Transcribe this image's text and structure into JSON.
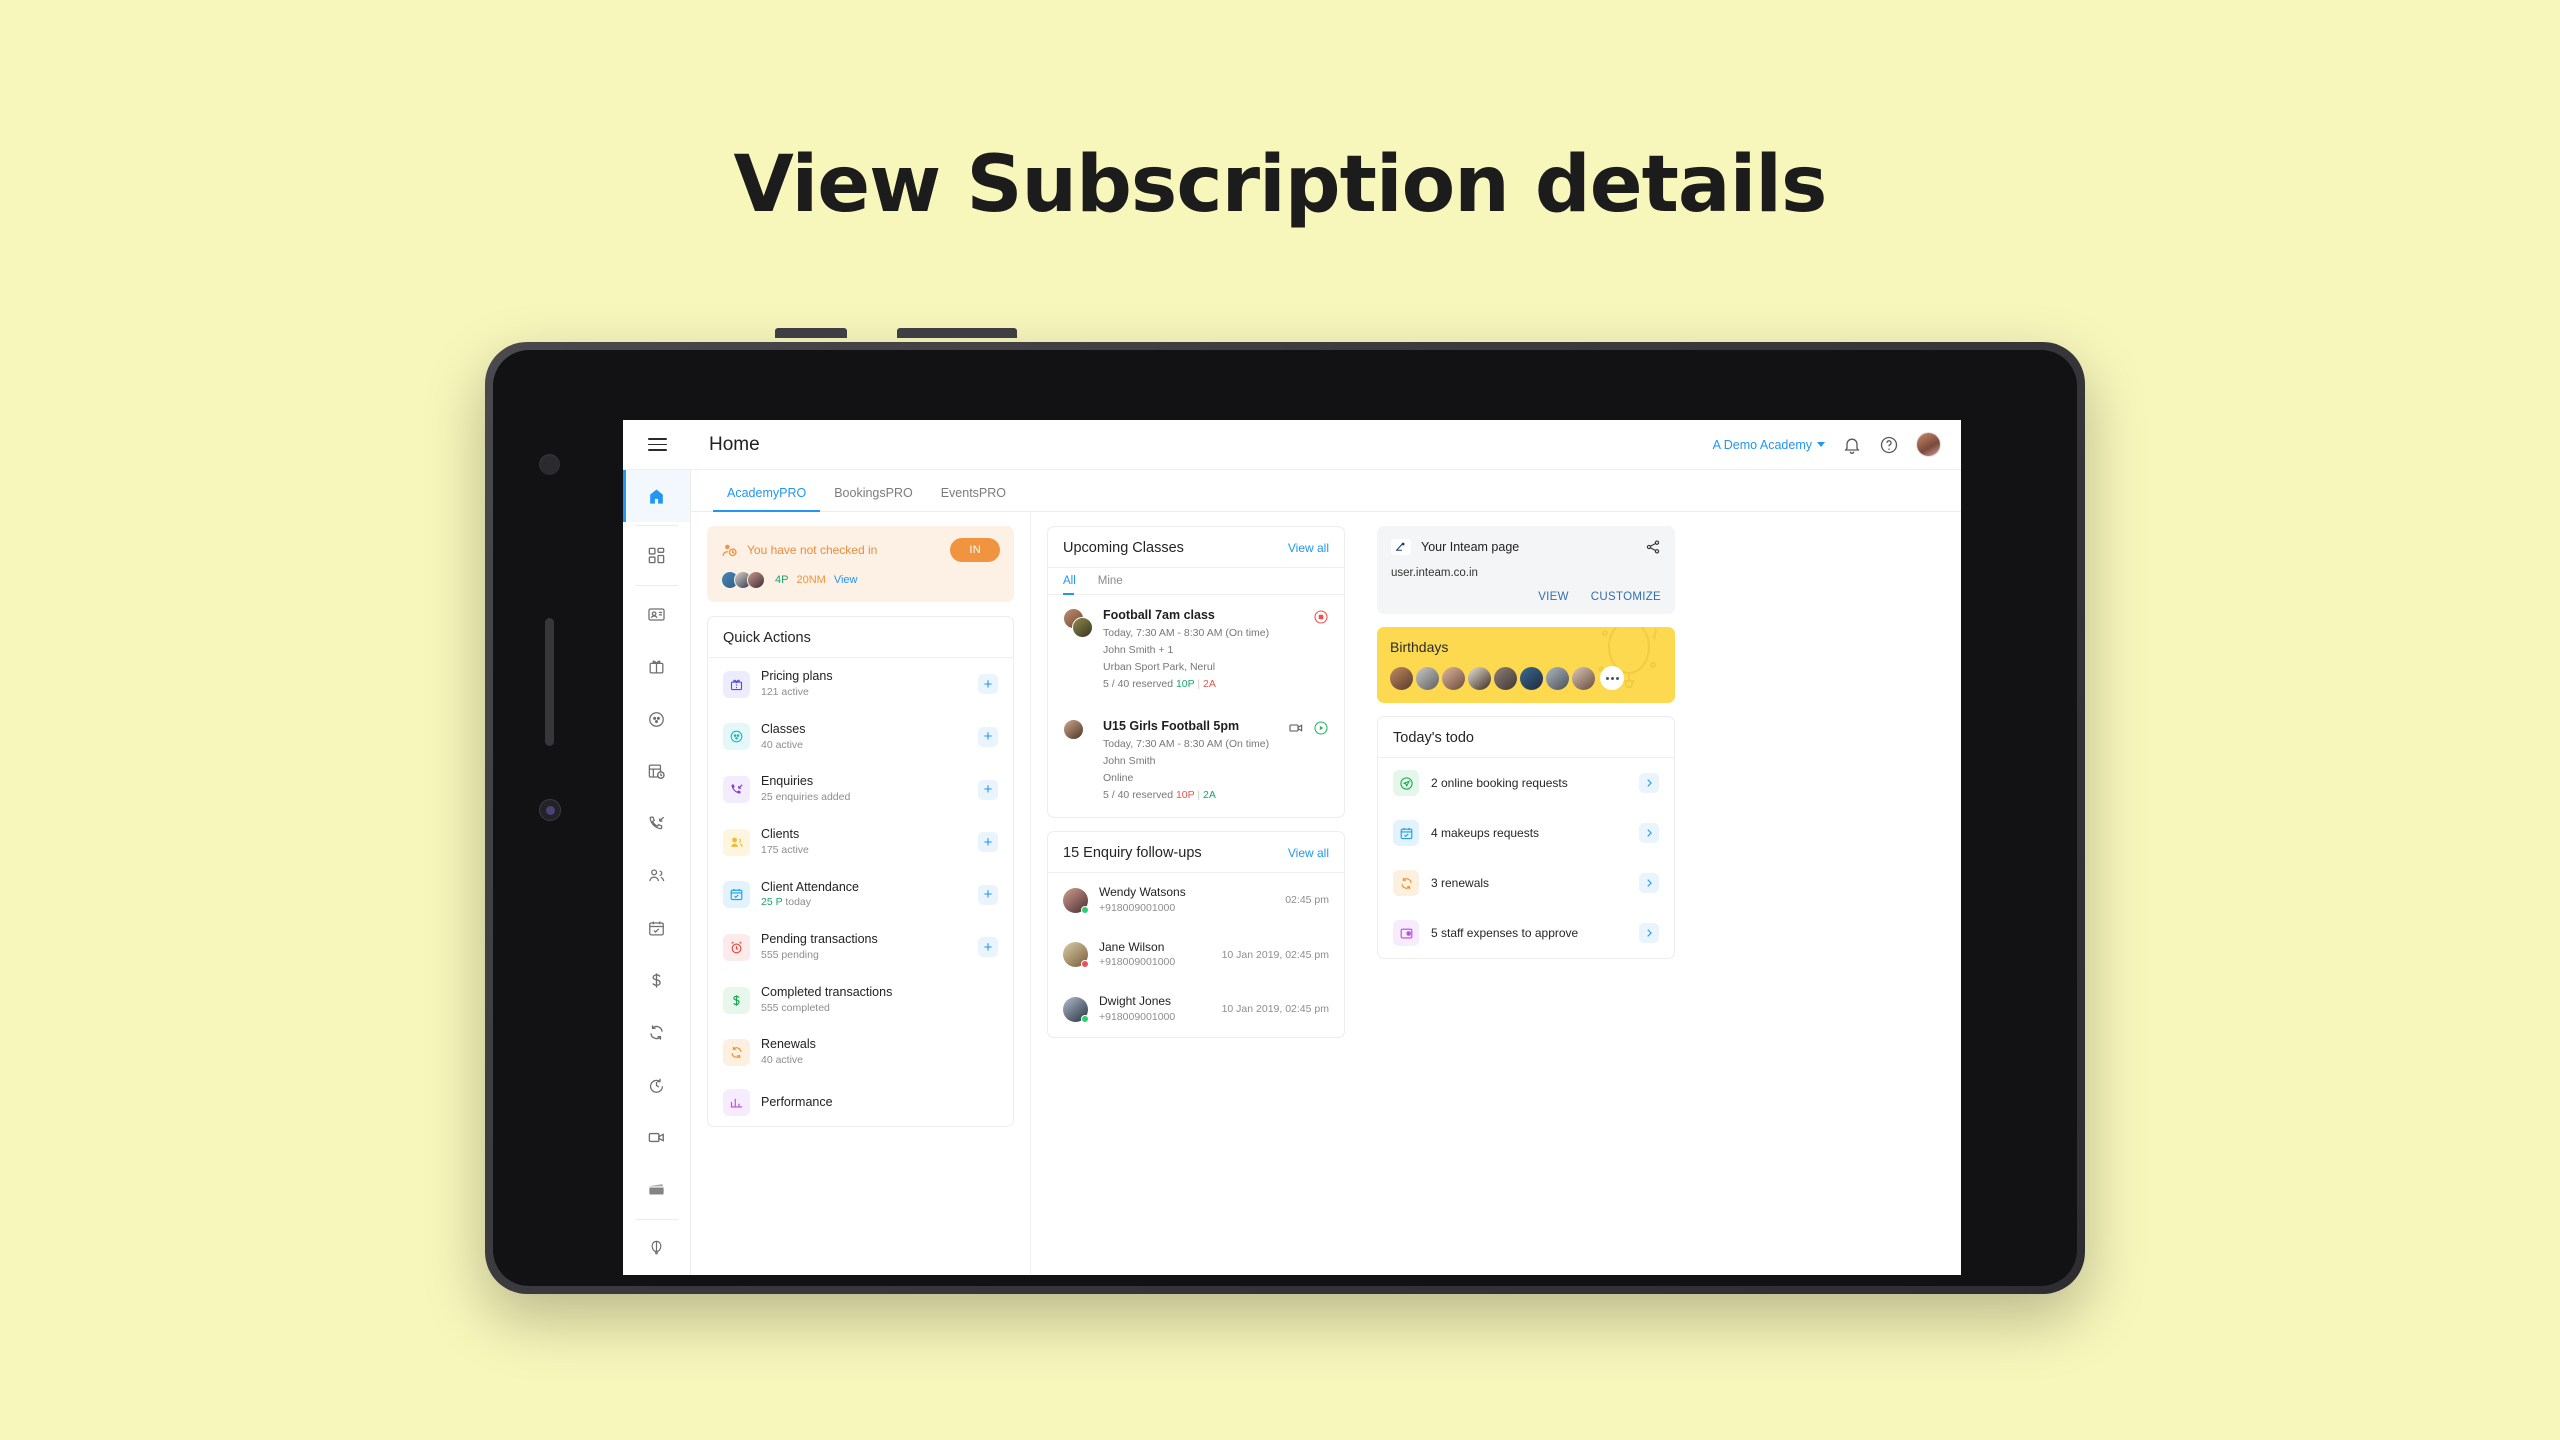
{
  "hero": {
    "title": "View Subscription details"
  },
  "header": {
    "menu_icon": "hamburger-icon",
    "page_title": "Home",
    "academy": "A Demo Academy",
    "bell_icon": "bell-icon",
    "help_icon": "help-circle-icon",
    "avatar": "user-avatar"
  },
  "tabs": [
    {
      "label": "AcademyPRO",
      "active": true
    },
    {
      "label": "BookingsPRO",
      "active": false
    },
    {
      "label": "EventsPRO",
      "active": false
    }
  ],
  "sidebar": {
    "items": [
      {
        "name": "home",
        "active": true
      },
      {
        "name": "dashboard",
        "active": false
      },
      {
        "name": "id-card",
        "active": false
      },
      {
        "name": "gift",
        "active": false
      },
      {
        "name": "classes",
        "active": false
      },
      {
        "name": "schedule",
        "active": false
      },
      {
        "name": "enquiries",
        "active": false
      },
      {
        "name": "clients",
        "active": false
      },
      {
        "name": "attendance",
        "active": false
      },
      {
        "name": "payments",
        "active": false
      },
      {
        "name": "renewals",
        "active": false
      },
      {
        "name": "timer",
        "active": false
      },
      {
        "name": "video",
        "active": false
      },
      {
        "name": "card",
        "active": false
      },
      {
        "name": "balloon",
        "active": false
      }
    ]
  },
  "checkin": {
    "message": "You have not checked in",
    "button": "IN",
    "present": "4P",
    "not_marked": "20NM",
    "view": "View",
    "avatar_colors": [
      "#4a86b8",
      "#2b3a56",
      "#5b3a4e"
    ]
  },
  "quick_actions": {
    "title": "Quick Actions",
    "items": [
      {
        "name": "Pricing plans",
        "sub": "121 active",
        "sub_green": "",
        "icon": "gift-icon",
        "bg": "#edecfd",
        "fg": "#5b4ddb",
        "plus": true
      },
      {
        "name": "Classes",
        "sub": "40 active",
        "sub_green": "",
        "icon": "class-icon",
        "bg": "#e4f8f9",
        "fg": "#15b8c4",
        "plus": true
      },
      {
        "name": "Enquiries",
        "sub": "25 enquiries added",
        "sub_green": "",
        "icon": "phone-incoming-icon",
        "bg": "#f2ecfd",
        "fg": "#7c3fd6",
        "plus": true
      },
      {
        "name": "Clients",
        "sub": "175 active",
        "sub_green": "",
        "icon": "people-icon",
        "bg": "#fdf5dd",
        "fg": "#f0bc33",
        "plus": true
      },
      {
        "name": "Client Attendance",
        "sub": " today",
        "sub_green": "25 P",
        "icon": "calendar-check-icon",
        "bg": "#e3f3fd",
        "fg": "#1aa0e8",
        "plus": true
      },
      {
        "name": "Pending transactions",
        "sub": "555 pending",
        "sub_green": "",
        "icon": "alarm-icon",
        "bg": "#fdeaea",
        "fg": "#e8453c",
        "plus": true
      },
      {
        "name": "Completed transactions",
        "sub": "555 completed",
        "sub_green": "",
        "icon": "dollar-icon",
        "bg": "#e7f7ec",
        "fg": "#1aa855",
        "plus": false
      },
      {
        "name": "Renewals",
        "sub": "40 active",
        "sub_green": "",
        "icon": "renew-icon",
        "bg": "#fdf0e0",
        "fg": "#f09423",
        "plus": false
      },
      {
        "name": "Performance",
        "sub": "",
        "sub_green": "",
        "icon": "performance-icon",
        "bg": "#f7ecfd",
        "fg": "#b64ddb",
        "plus": false
      }
    ]
  },
  "upcoming": {
    "title": "Upcoming Classes",
    "view_all": "View all",
    "tabs": [
      {
        "label": "All",
        "active": true
      },
      {
        "label": "Mine",
        "active": false
      }
    ],
    "classes": [
      {
        "name": "Football 7am class",
        "time": "Today, 7:30 AM - 8:30 AM (On time)",
        "coach": "John Smith + 1",
        "location": "Urban Sport Park, Nerul",
        "reserved": "5 / 40 reserved",
        "present": "10P",
        "absent": "2A",
        "present_color": "#1aa56b",
        "absent_color": "#e8534f",
        "actions": [
          "stop-record-icon"
        ]
      },
      {
        "name": "U15 Girls Football 5pm",
        "time": "Today, 7:30 AM - 8:30 AM (On time)",
        "coach": "John Smith",
        "location": "Online",
        "reserved": "5 / 40 reserved",
        "present": "10P",
        "absent": "2A",
        "present_color": "#e8534f",
        "absent_color": "#1aa56b",
        "actions": [
          "video-icon",
          "play-icon"
        ]
      }
    ]
  },
  "enquiries": {
    "title": "15 Enquiry follow-ups",
    "view_all": "View all",
    "rows": [
      {
        "name": "Wendy Watsons",
        "phone": "+918009001000",
        "time": "02:45 pm",
        "status": "#2ecc71",
        "av": "#5b3a4e"
      },
      {
        "name": "Jane Wilson",
        "phone": "+918009001000",
        "time": "10 Jan 2019, 02:45 pm",
        "status": "#ef4e5a",
        "av": "#8a7f5c"
      },
      {
        "name": "Dwight Jones",
        "phone": "+918009001000",
        "time": "10 Jan 2019, 02:45 pm",
        "status": "#2ecc71",
        "av": "#3d4a63"
      }
    ]
  },
  "inteam": {
    "title": "Your Inteam page",
    "url": "user.inteam.co.in",
    "view": "VIEW",
    "customize": "CUSTOMIZE",
    "share_icon": "share-icon"
  },
  "birthdays": {
    "title": "Birthdays",
    "avatar_colors": [
      "#9c6246",
      "#8a8a8a",
      "#c3907e",
      "#4a3a30",
      "#6b5f5a",
      "#2f4a66",
      "#7d8892",
      "#b07a62"
    ],
    "more_icon": "more-dots-icon"
  },
  "todo": {
    "title": "Today's todo",
    "items": [
      {
        "label": "2 online booking requests",
        "icon": "send-circle-icon",
        "bg": "#e4f7ea",
        "fg": "#1aa855"
      },
      {
        "label": "4 makeups requests",
        "icon": "calendar-check-icon",
        "bg": "#e3f3fd",
        "fg": "#1aa0e8"
      },
      {
        "label": "3 renewals",
        "icon": "renew-icon",
        "bg": "#fdf0e0",
        "fg": "#f09423"
      },
      {
        "label": "5 staff expenses to approve",
        "icon": "wallet-icon",
        "bg": "#f7ecfd",
        "fg": "#b64ddb"
      }
    ]
  },
  "colors": {
    "page_bg": "#f7f6bb",
    "accent": "#2196f3",
    "warn": "#f0943f",
    "birthday": "#fcd94f"
  }
}
